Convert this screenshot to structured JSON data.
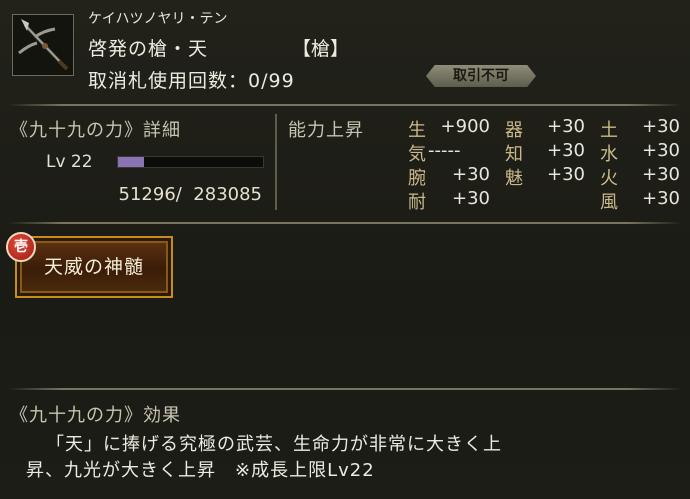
{
  "header": {
    "reading": "ケイハツノヤリ・テン",
    "name": "啓発の槍・天",
    "type": "【槍】",
    "cancel_count": "取消札使用回数：0/99",
    "trade_status": "取引不可",
    "icon": "spear-icon"
  },
  "power": {
    "title": "《九十九の力》詳細",
    "level_label": "Lv 22",
    "xp_fraction": 0.18,
    "xp_text": "51296/  283085",
    "bar_color": "#8a73b5"
  },
  "stats": {
    "title": "能力上昇",
    "items": [
      {
        "k": "生",
        "v": "+900"
      },
      {
        "k": "気",
        "v": "-----"
      },
      {
        "k": "腕",
        "v": "+30"
      },
      {
        "k": "耐",
        "v": "+30"
      },
      {
        "k": "器",
        "v": "+30"
      },
      {
        "k": "知",
        "v": "+30"
      },
      {
        "k": "魅",
        "v": "+30"
      },
      {
        "k": "土",
        "v": "+30"
      },
      {
        "k": "水",
        "v": "+30"
      },
      {
        "k": "火",
        "v": "+30"
      },
      {
        "k": "風",
        "v": "+30"
      }
    ]
  },
  "skill": {
    "rank": "壱",
    "name": "天威の神髄"
  },
  "effect": {
    "title": "《九十九の力》効果",
    "line1": "「天」に捧げる究極の武芸、生命力が非常に大きく上",
    "line2": "昇、九光が大きく上昇　※成長上限Lv22"
  }
}
